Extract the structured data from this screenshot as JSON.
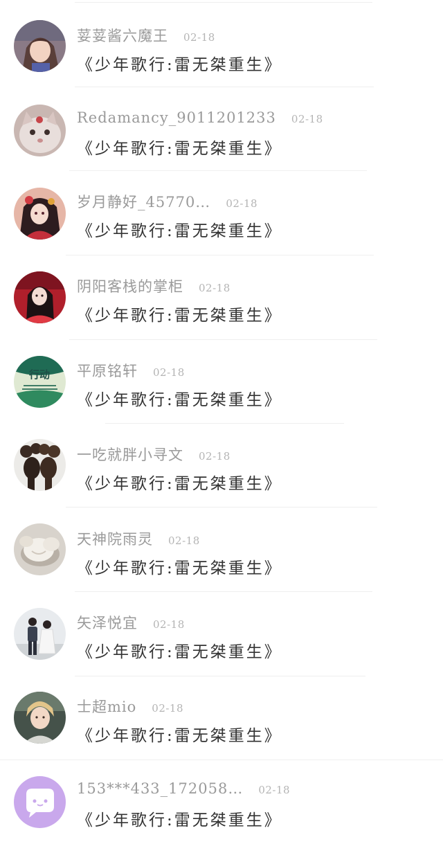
{
  "comments": [
    {
      "username": "荽荽酱六魔王",
      "date": "02-18",
      "text": "《少年歌行:雷无桀重生》",
      "avatar": "girl-avatar-icon"
    },
    {
      "username": "Redamancy_9011201233",
      "date": "02-18",
      "text": "《少年歌行:雷无桀重生》",
      "avatar": "cat-avatar-icon"
    },
    {
      "username": "岁月静好_45770…",
      "date": "02-18",
      "text": "《少年歌行:雷无桀重生》",
      "avatar": "anime-girl-avatar-icon"
    },
    {
      "username": "阴阳客栈的掌柜",
      "date": "02-18",
      "text": "《少年歌行:雷无桀重生》",
      "avatar": "red-dress-avatar-icon"
    },
    {
      "username": "平原铭轩",
      "date": "02-18",
      "text": "《少年歌行:雷无桀重生》",
      "avatar": "action-badge-avatar-icon",
      "avatar_text": "行动"
    },
    {
      "username": "一吃就胖小寻文",
      "date": "02-18",
      "text": "《少年歌行:雷无桀重生》",
      "avatar": "mice-figures-avatar-icon"
    },
    {
      "username": "天神院雨灵",
      "date": "02-18",
      "text": "《少年歌行:雷无桀重生》",
      "avatar": "dumpling-avatar-icon"
    },
    {
      "username": "矢泽悦宜",
      "date": "02-18",
      "text": "《少年歌行:雷无桀重生》",
      "avatar": "couple-avatar-icon"
    },
    {
      "username": "士超mio",
      "date": "02-18",
      "text": "《少年歌行:雷无桀重生》",
      "avatar": "boy-avatar-icon"
    },
    {
      "username": "153***433_172058…",
      "date": "02-18",
      "text": "《少年歌行:雷无桀重生》",
      "avatar": "chat-bubble-avatar-icon"
    }
  ],
  "colors": {
    "username": "#9a9a9a",
    "date": "#b4b4b4",
    "comment": "#333333",
    "divider": "#efefef",
    "default_avatar": "#c9a8ec"
  }
}
